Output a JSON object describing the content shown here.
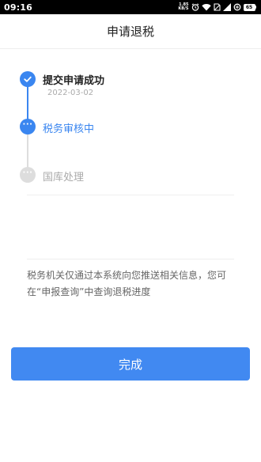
{
  "status_bar": {
    "time": "09:16",
    "net_speed_value": "1.85",
    "net_speed_unit": "KB/S",
    "battery": "65",
    "icons": [
      "alarm-icon",
      "wifi-icon",
      "no-sim-icon",
      "signal-icon",
      "data-saver-icon",
      "battery-icon"
    ]
  },
  "nav": {
    "title": "申请退税"
  },
  "timeline": {
    "steps": [
      {
        "title": "提交申请成功",
        "date": "2022-03-02",
        "state": "done"
      },
      {
        "title": "税务审核中",
        "state": "active"
      },
      {
        "title": "国库处理",
        "state": "pending"
      }
    ],
    "dots_glyph": "···"
  },
  "notice": {
    "text": "税务机关仅通过本系统向您推送相关信息，您可在“申报查询”中查询退税进度"
  },
  "footer": {
    "done_label": "完成"
  },
  "colors": {
    "accent": "#3a86f0",
    "pending": "#dddddd",
    "button": "#4189f1"
  }
}
